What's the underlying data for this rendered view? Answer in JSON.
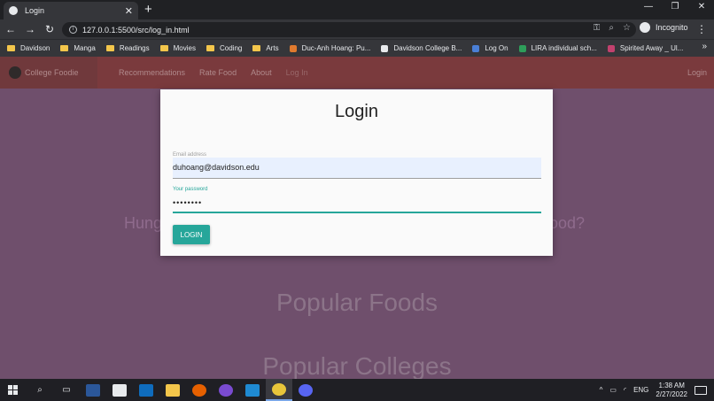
{
  "browser": {
    "tab_title": "Login",
    "tab_close": "✕",
    "new_tab": "+",
    "window_controls": [
      "—",
      "❐",
      "✕"
    ],
    "back": "←",
    "forward": "→",
    "reload": "↻",
    "url": "127.0.0.1:5500/src/log_in.html",
    "incognito_label": "Incognito",
    "menu": "⋮",
    "bookmarks": [
      {
        "label": "Davidson",
        "kind": "folder"
      },
      {
        "label": "Manga",
        "kind": "folder"
      },
      {
        "label": "Readings",
        "kind": "folder"
      },
      {
        "label": "Movies",
        "kind": "folder"
      },
      {
        "label": "Coding",
        "kind": "folder"
      },
      {
        "label": "Arts",
        "kind": "folder"
      },
      {
        "label": "Duc-Anh Hoang: Pu...",
        "kind": "site",
        "color": "#e07a2e"
      },
      {
        "label": "Davidson College B...",
        "kind": "site",
        "color": "#e8eaed"
      },
      {
        "label": "Log On",
        "kind": "site",
        "color": "#4a7fd6"
      },
      {
        "label": "LIRA individual sch...",
        "kind": "site",
        "color": "#2e9e5a"
      },
      {
        "label": "Spirited Away _ Ul...",
        "kind": "site",
        "color": "#c2416e"
      }
    ],
    "bookmarks_more": "»"
  },
  "site": {
    "brand": "College Foodie",
    "nav_links": [
      "Recommendations",
      "Rate Food",
      "About",
      "Log In"
    ],
    "nav_login": "Login",
    "hero_left": "Hung",
    "hero_right": "ood?",
    "section_popular_foods": "Popular Foods",
    "section_popular_colleges": "Popular Colleges"
  },
  "login_modal": {
    "title": "Login",
    "email_label": "Email address",
    "email_value": "duhoang@davidson.edu",
    "password_label": "Your password",
    "password_value": "••••••••",
    "login_button": "LOGIN"
  },
  "taskbar": {
    "time": "1:38 AM",
    "date": "2/27/2022",
    "language": "ENG"
  },
  "colors": {
    "accent": "#26a69a",
    "navbar": "#7a3a3d",
    "page_background": "#6f4f6c"
  }
}
